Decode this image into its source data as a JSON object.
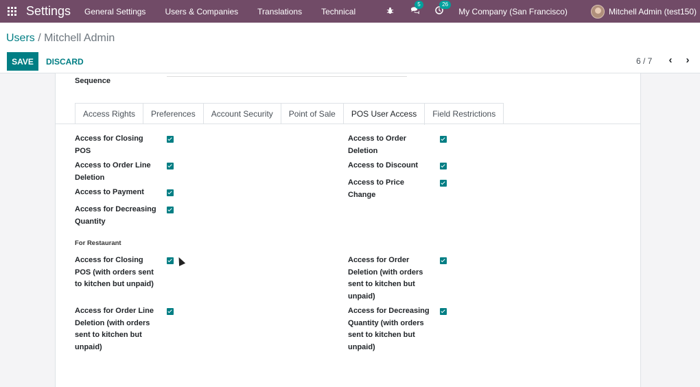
{
  "navbar": {
    "brand": "Settings",
    "menu": [
      "General Settings",
      "Users & Companies",
      "Translations",
      "Technical"
    ],
    "chat_badge": "5",
    "activity_badge": "26",
    "company": "My Company (San Francisco)",
    "user": "Mitchell Admin (test150)"
  },
  "breadcrumb": {
    "parent": "Users",
    "separator": " / ",
    "current": "Mitchell Admin"
  },
  "actions": {
    "save": "SAVE",
    "discard": "DISCARD"
  },
  "pager": {
    "value": "6 / 7"
  },
  "form": {
    "sequence_label": "Sequence"
  },
  "tabs": [
    "Access Rights",
    "Preferences",
    "Account Security",
    "Point of Sale",
    "POS User Access",
    "Field Restrictions"
  ],
  "active_tab": "POS User Access",
  "pos_access": [
    {
      "label": "Access for Closing POS",
      "checked": true
    },
    {
      "label": "Access to Order Deletion",
      "checked": true
    },
    {
      "label": "Access to Order Line Deletion",
      "checked": true
    },
    {
      "label": "Access to Discount",
      "checked": true
    },
    {
      "label": "Access to Payment",
      "checked": true
    },
    {
      "label": "Access to Price Change",
      "checked": true
    },
    {
      "label": "Access for Decreasing Quantity",
      "checked": true
    }
  ],
  "restaurant": {
    "title": "For Restaurant",
    "fields": [
      {
        "label": "Access for Closing POS (with orders sent to kitchen but unpaid)",
        "checked": true
      },
      {
        "label": "Access for Order Deletion (with orders sent to kitchen but unpaid)",
        "checked": true
      },
      {
        "label": "Access for Order Line Deletion (with orders sent to kitchen but unpaid)",
        "checked": true
      },
      {
        "label": "Access for Decreasing Quantity (with orders sent to kitchen but unpaid)",
        "checked": true
      }
    ]
  },
  "colors": {
    "navbar": "#714b67",
    "accent": "#017e84",
    "badge": "#00a09d"
  }
}
